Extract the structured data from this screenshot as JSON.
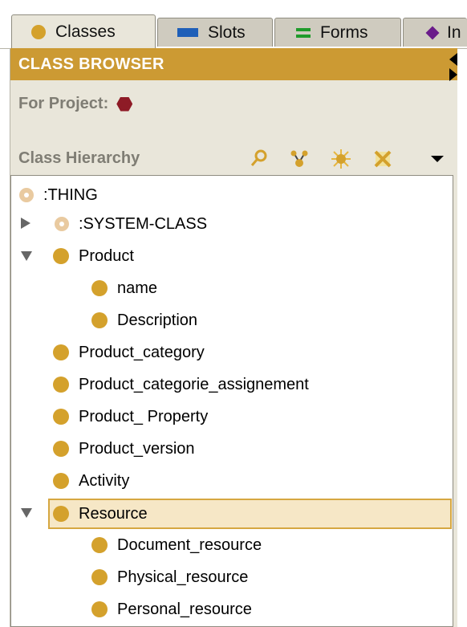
{
  "tabs": [
    {
      "label": "Classes",
      "icon": "class-dot-icon",
      "active": true
    },
    {
      "label": "Slots",
      "icon": "slot-bar-icon",
      "active": false
    },
    {
      "label": "Forms",
      "icon": "forms-icon",
      "active": false
    },
    {
      "label": "In",
      "icon": "instances-diamond-icon",
      "active": false
    }
  ],
  "browser": {
    "title": "CLASS BROWSER",
    "project_label": "For Project:",
    "hierarchy_label": "Class Hierarchy"
  },
  "toolbar_icons": [
    "search-class-icon",
    "create-subclass-icon",
    "create-instance-icon",
    "delete-class-icon",
    "menu-dropdown-icon"
  ],
  "tree": [
    {
      "label": ":THING",
      "kind": "system",
      "expander": "none",
      "level": 0
    },
    {
      "label": ":SYSTEM-CLASS",
      "kind": "system",
      "expander": "collapsed",
      "level": 1
    },
    {
      "label": "Product",
      "kind": "class",
      "expander": "expanded",
      "level": 1
    },
    {
      "label": "name",
      "kind": "class",
      "expander": "none",
      "level": 2
    },
    {
      "label": "Description",
      "kind": "class",
      "expander": "none",
      "level": 2
    },
    {
      "label": "Product_category",
      "kind": "class",
      "expander": "none",
      "level": 1
    },
    {
      "label": "Product_categorie_assignement",
      "kind": "class",
      "expander": "none",
      "level": 1
    },
    {
      "label": "Product_ Property",
      "kind": "class",
      "expander": "none",
      "level": 1
    },
    {
      "label": "Product_version",
      "kind": "class",
      "expander": "none",
      "level": 1
    },
    {
      "label": "Activity",
      "kind": "class",
      "expander": "none",
      "level": 1
    },
    {
      "label": "Resource",
      "kind": "class",
      "expander": "expanded",
      "level": 1,
      "selected": true
    },
    {
      "label": "Document_resource",
      "kind": "class",
      "expander": "none",
      "level": 2
    },
    {
      "label": "Physical_resource",
      "kind": "class",
      "expander": "none",
      "level": 2
    },
    {
      "label": "Personal_resource",
      "kind": "class",
      "expander": "none",
      "level": 2
    }
  ],
  "colors": {
    "header_bg": "#cc9a33",
    "class_ball": "#d4a12c",
    "selection_bg": "#f6e7c6",
    "project_icon": "#8e1b26"
  }
}
